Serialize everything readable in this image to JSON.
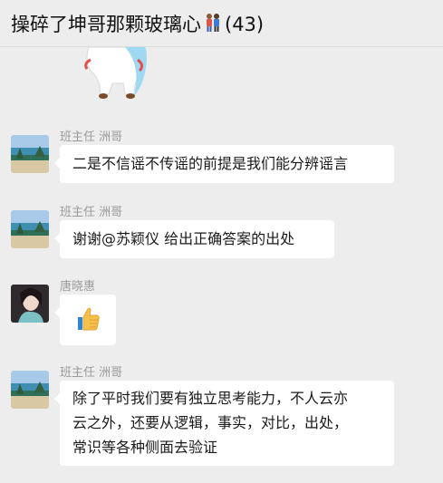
{
  "header": {
    "title": "操碎了坤哥那颗玻璃心",
    "member_count": "(43)"
  },
  "messages": [
    {
      "sender": "班主任 洲哥",
      "text": "二是不信谣不传谣的前提是我们能分辨谣言",
      "avatar": "beach-avatar"
    },
    {
      "sender": "班主任 洲哥",
      "text": "谢谢@苏颖仪 给出正确答案的出处",
      "avatar": "beach-avatar"
    },
    {
      "sender": "唐晓惠",
      "text": "",
      "avatar": "girl-avatar",
      "emoji": "thumbs-up-icon"
    },
    {
      "sender": "班主任 洲哥",
      "text_lines": [
        "除了平时我们要有独立思考能力，不人云亦",
        "云之外，还要从逻辑，事实，对比，出处，",
        "常识等各种侧面去验证"
      ],
      "avatar": "beach-avatar"
    }
  ],
  "colors": {
    "background": "#ededed",
    "bubble": "#ffffff",
    "sender": "#9a9a9a"
  }
}
